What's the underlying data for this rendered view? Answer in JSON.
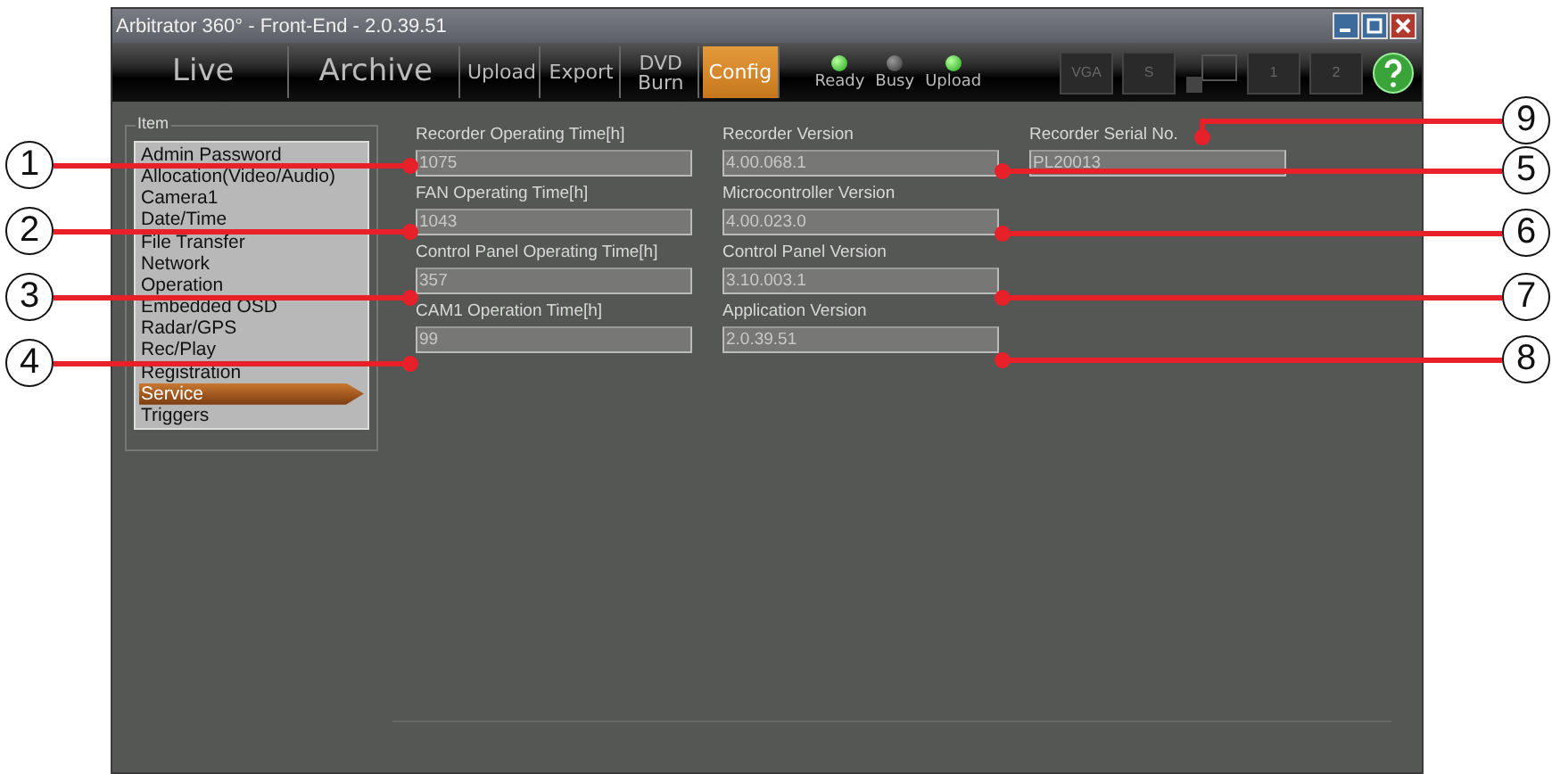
{
  "window": {
    "title": "Arbitrator 360° - Front-End - 2.0.39.51"
  },
  "tabs": [
    {
      "label": "Live",
      "selected": false,
      "kind": "large"
    },
    {
      "label": "Archive",
      "selected": false,
      "kind": "large"
    },
    {
      "label": "Upload",
      "selected": false,
      "kind": "small"
    },
    {
      "label": "Export",
      "selected": false,
      "kind": "small"
    },
    {
      "label": "DVD Burn",
      "selected": false,
      "kind": "small"
    },
    {
      "label": "Config",
      "selected": true,
      "kind": "small"
    }
  ],
  "lights": [
    {
      "label": "Ready",
      "on": true
    },
    {
      "label": "Busy",
      "on": false
    },
    {
      "label": "Upload",
      "on": true
    }
  ],
  "tool_buttons": [
    {
      "kind": "box",
      "label": "VGA"
    },
    {
      "kind": "box",
      "label": "S"
    },
    {
      "kind": "pip"
    },
    {
      "kind": "box",
      "label": "1"
    },
    {
      "kind": "box",
      "label": "2"
    },
    {
      "kind": "help"
    }
  ],
  "sidebar": {
    "legend": "Item",
    "items": [
      {
        "label": "Admin Password",
        "selected": false
      },
      {
        "label": "Allocation(Video/Audio)",
        "selected": false
      },
      {
        "label": "Camera1",
        "selected": false
      },
      {
        "label": "Date/Time",
        "selected": false
      },
      {
        "label": "File Transfer",
        "selected": false
      },
      {
        "label": "Network",
        "selected": false
      },
      {
        "label": "Operation",
        "selected": false
      },
      {
        "label": "Embedded OSD",
        "selected": false
      },
      {
        "label": "Radar/GPS",
        "selected": false
      },
      {
        "label": "Rec/Play",
        "selected": false
      },
      {
        "label": "Registration",
        "selected": false
      },
      {
        "label": "Service",
        "selected": true
      },
      {
        "label": "Triggers",
        "selected": false
      }
    ]
  },
  "field_columns": [
    [
      {
        "label": "Recorder Operating Time[h]",
        "value": "1075"
      },
      {
        "label": "FAN Operating Time[h]",
        "value": "1043"
      },
      {
        "label": "Control Panel Operating Time[h]",
        "value": "357"
      },
      {
        "label": "CAM1 Operation Time[h]",
        "value": "99"
      }
    ],
    [
      {
        "label": "Recorder Version",
        "value": "4.00.068.1"
      },
      {
        "label": "Microcontroller Version",
        "value": "4.00.023.0"
      },
      {
        "label": "Control Panel Version",
        "value": "3.10.003.1"
      },
      {
        "label": "Application Version",
        "value": "2.0.39.51"
      }
    ],
    [
      {
        "label": "Recorder Serial No.",
        "value": "PL20013"
      }
    ]
  ],
  "callouts": [
    {
      "number": "1"
    },
    {
      "number": "2"
    },
    {
      "number": "3"
    },
    {
      "number": "4"
    },
    {
      "number": "9"
    },
    {
      "number": "5"
    },
    {
      "number": "6"
    },
    {
      "number": "7"
    },
    {
      "number": "8"
    }
  ]
}
